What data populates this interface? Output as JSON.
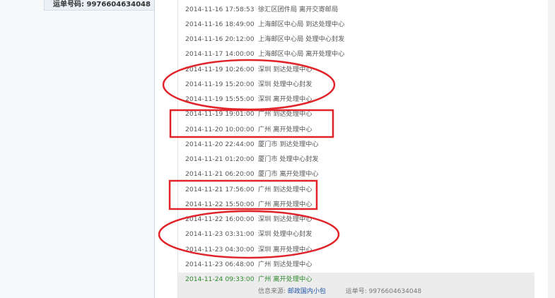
{
  "left_panel": {
    "waybill_label": "运单号码:",
    "waybill_number": "9976604634048"
  },
  "tracking": {
    "rows": [
      {
        "time": "2014-11-16 17:58:53",
        "event": "徐汇区团件局 离开交寄邮局"
      },
      {
        "time": "2014-11-16 18:49:00",
        "event": "上海邮区中心局 到达处理中心"
      },
      {
        "time": "2014-11-16 20:12:00",
        "event": "上海邮区中心局 处理中心封发"
      },
      {
        "time": "2014-11-17 14:00:00",
        "event": "上海邮区中心局 离开处理中心"
      },
      {
        "time": "2014-11-19 10:26:00",
        "event": "深圳 到达处理中心"
      },
      {
        "time": "2014-11-19 15:20:00",
        "event": "深圳 处理中心封发"
      },
      {
        "time": "2014-11-19 15:55:00",
        "event": "深圳 离开处理中心"
      },
      {
        "time": "2014-11-19 19:01:00",
        "event": "广州 到达处理中心"
      },
      {
        "time": "2014-11-20 10:00:00",
        "event": "广州 离开处理中心"
      },
      {
        "time": "2014-11-20 22:44:00",
        "event": "厦门市 到达处理中心"
      },
      {
        "time": "2014-11-21 01:20:00",
        "event": "厦门市 处理中心封发"
      },
      {
        "time": "2014-11-21 06:20:00",
        "event": "厦门市 离开处理中心"
      },
      {
        "time": "2014-11-21 17:56:00",
        "event": "广州 到达处理中心"
      },
      {
        "time": "2014-11-22 15:50:00",
        "event": "广州 离开处理中心"
      },
      {
        "time": "2014-11-22 16:00:00",
        "event": "深圳 到达处理中心"
      },
      {
        "time": "2014-11-23 03:31:00",
        "event": "深圳 处理中心封发"
      },
      {
        "time": "2014-11-23 04:30:00",
        "event": "深圳 离开处理中心"
      },
      {
        "time": "2014-11-23 06:48:00",
        "event": "广州 到达处理中心"
      },
      {
        "time": "2014-11-24 09:33:00",
        "event": "广州 离开处理中心"
      }
    ],
    "source_label": "信息来源:",
    "source_link": "邮政国内小包",
    "number_label": "运单号:",
    "number_value": "9976604634048"
  },
  "colors": {
    "annotation_red": "#e0242a",
    "latest_green": "#2e8b2e"
  }
}
